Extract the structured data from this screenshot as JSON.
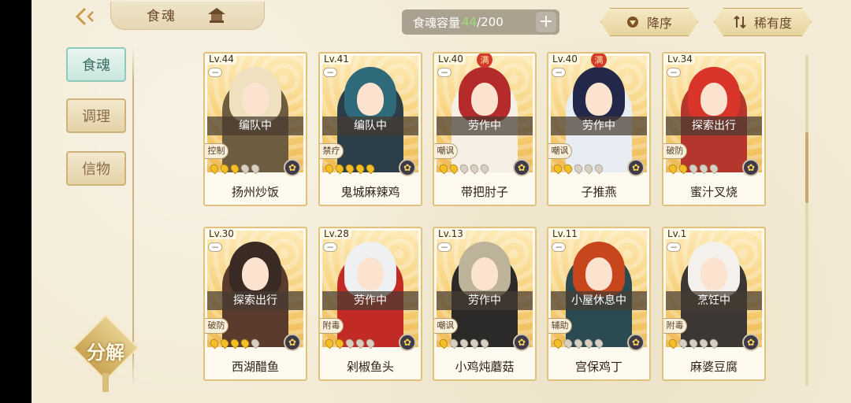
{
  "header": {
    "title": "食魂",
    "capacity_label": "食魂容量",
    "capacity_current": "44",
    "capacity_max": "/200",
    "add_symbol": "+",
    "sort_desc_label": "降序",
    "sort_rarity_label": "稀有度"
  },
  "nav": {
    "items": [
      {
        "label": "食魂",
        "active": true
      },
      {
        "label": "调理",
        "active": false
      },
      {
        "label": "信物",
        "active": false
      }
    ],
    "decompose_label": "分解"
  },
  "cards": [
    {
      "level": "Lv.44",
      "status": "编队中",
      "role": "控制",
      "name": "扬州炒饭",
      "stars": 3,
      "full": false,
      "hair": "#efe1bf",
      "outfit": "#6d5c3f"
    },
    {
      "level": "Lv.41",
      "status": "编队中",
      "role": "禁疗",
      "name": "鬼城麻辣鸡",
      "stars": 5,
      "full": false,
      "hair": "#2e6a7a",
      "outfit": "#2c3f48"
    },
    {
      "level": "Lv.40",
      "status": "劳作中",
      "role": "嘲讽",
      "name": "带把肘子",
      "stars": 2,
      "full": true,
      "full_label": "满",
      "hair": "#b52a2a",
      "outfit": "#f5efe6"
    },
    {
      "level": "Lv.40",
      "status": "劳作中",
      "role": "嘲讽",
      "name": "子推燕",
      "stars": 2,
      "full": true,
      "full_label": "满",
      "hair": "#23284a",
      "outfit": "#e8ecf3"
    },
    {
      "level": "Lv.34",
      "status": "探索出行",
      "role": "破防",
      "name": "蜜汁叉烧",
      "stars": 2,
      "full": false,
      "hair": "#d8342a",
      "outfit": "#b5362c"
    },
    {
      "level": "Lv.30",
      "status": "探索出行",
      "role": "破防",
      "name": "西湖醋鱼",
      "stars": 4,
      "full": false,
      "hair": "#3a2a24",
      "outfit": "#5a3b2e"
    },
    {
      "level": "Lv.28",
      "status": "劳作中",
      "role": "附毒",
      "name": "剁椒鱼头",
      "stars": 2,
      "full": false,
      "hair": "#eef0f2",
      "outfit": "#c22b25"
    },
    {
      "level": "Lv.13",
      "status": "劳作中",
      "role": "嘲讽",
      "name": "小鸡炖蘑菇",
      "stars": 1,
      "full": false,
      "hair": "#bdb39a",
      "outfit": "#2b2a28"
    },
    {
      "level": "Lv.11",
      "status": "小屋休息中",
      "role": "辅助",
      "name": "宫保鸡丁",
      "stars": 1,
      "full": false,
      "hair": "#c8461e",
      "outfit": "#2b4a52"
    },
    {
      "level": "Lv.1",
      "status": "烹饪中",
      "role": "附毒",
      "name": "麻婆豆腐",
      "stars": 1,
      "full": false,
      "hair": "#f4f1ec",
      "outfit": "#3c3634"
    }
  ],
  "icons": {
    "back": "back-arrow-icon",
    "home": "home-pavilion-icon",
    "sort_desc": "triangle-down-icon",
    "sort_rarity": "sort-arrows-icon",
    "element": "element-flower-icon"
  }
}
